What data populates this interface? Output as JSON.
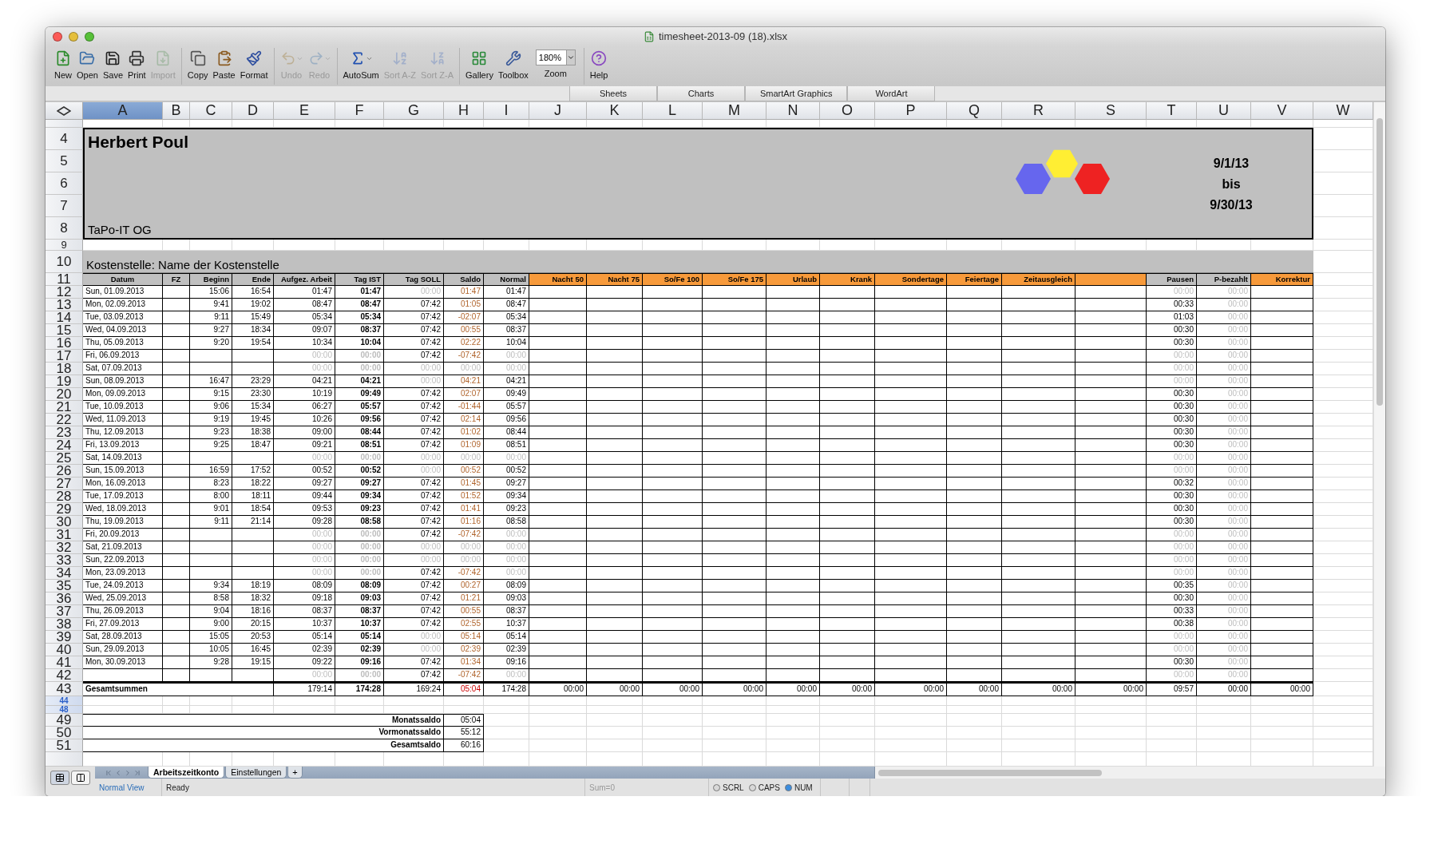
{
  "window": {
    "title": "timesheet-2013-09 (18).xlsx"
  },
  "toolbar": {
    "groups": [
      [
        {
          "kind": "button",
          "label": "New",
          "disabled": false
        },
        {
          "kind": "button",
          "label": "Open",
          "disabled": false
        },
        {
          "kind": "button",
          "label": "Save",
          "disabled": false
        },
        {
          "kind": "button",
          "label": "Print",
          "disabled": false
        },
        {
          "kind": "button",
          "label": "Import",
          "disabled": true
        }
      ],
      [
        {
          "kind": "button",
          "label": "Copy",
          "disabled": false
        },
        {
          "kind": "button",
          "label": "Paste",
          "disabled": false
        },
        {
          "kind": "button",
          "label": "Format",
          "disabled": false
        }
      ],
      [
        {
          "kind": "button",
          "label": "Undo",
          "disabled": true,
          "dropdown": true
        },
        {
          "kind": "button",
          "label": "Redo",
          "disabled": true,
          "dropdown": true
        }
      ],
      [
        {
          "kind": "button",
          "label": "AutoSum",
          "disabled": false,
          "dropdown": true
        },
        {
          "kind": "button",
          "label": "Sort A-Z",
          "disabled": true
        },
        {
          "kind": "button",
          "label": "Sort Z-A",
          "disabled": true
        }
      ],
      [
        {
          "kind": "button",
          "label": "Gallery",
          "disabled": false
        },
        {
          "kind": "button",
          "label": "Toolbox",
          "disabled": false
        },
        {
          "kind": "zoom",
          "label": "Zoom",
          "value": "180%"
        }
      ],
      [
        {
          "kind": "button",
          "label": "Help",
          "disabled": false
        }
      ]
    ]
  },
  "ribbon_tabs": [
    "Sheets",
    "Charts",
    "SmartArt Graphics",
    "WordArt"
  ],
  "column_letters": [
    {
      "label": "A",
      "selected": true
    },
    {
      "label": "B",
      "selected": false
    },
    {
      "label": "C",
      "selected": false
    },
    {
      "label": "D",
      "selected": false
    },
    {
      "label": "E",
      "selected": false
    },
    {
      "label": "F",
      "selected": false
    },
    {
      "label": "G",
      "selected": false
    },
    {
      "label": "H",
      "selected": false
    },
    {
      "label": "I",
      "selected": false
    },
    {
      "label": "J",
      "selected": false
    },
    {
      "label": "K",
      "selected": false
    },
    {
      "label": "L",
      "selected": false
    },
    {
      "label": "M",
      "selected": false
    },
    {
      "label": "N",
      "selected": false
    },
    {
      "label": "O",
      "selected": false
    },
    {
      "label": "P",
      "selected": false
    },
    {
      "label": "Q",
      "selected": false
    },
    {
      "label": "R",
      "selected": false
    },
    {
      "label": "S",
      "selected": false
    },
    {
      "label": "T",
      "selected": false
    },
    {
      "label": "U",
      "selected": false
    },
    {
      "label": "V",
      "selected": false
    },
    {
      "label": "W",
      "selected": false
    }
  ],
  "row_numbers": [
    {
      "highlight": false
    },
    {
      "label": "4",
      "highlight": false
    },
    {
      "label": "5",
      "highlight": false
    },
    {
      "label": "6",
      "highlight": false
    },
    {
      "label": "7",
      "highlight": false
    },
    {
      "label": "8",
      "highlight": false
    },
    {
      "label": "9",
      "highlight": false
    },
    {
      "label": "10",
      "highlight": false
    },
    {
      "label": "11",
      "highlight": false
    },
    {
      "label": "12",
      "highlight": false
    },
    {
      "label": "13",
      "highlight": false
    },
    {
      "label": "14",
      "highlight": false
    },
    {
      "label": "15",
      "highlight": false
    },
    {
      "label": "16",
      "highlight": false
    },
    {
      "label": "17",
      "highlight": false
    },
    {
      "label": "18",
      "highlight": false
    },
    {
      "label": "19",
      "highlight": false
    },
    {
      "label": "20",
      "highlight": false
    },
    {
      "label": "21",
      "highlight": false
    },
    {
      "label": "22",
      "highlight": false
    },
    {
      "label": "23",
      "highlight": false
    },
    {
      "label": "24",
      "highlight": false
    },
    {
      "label": "25",
      "highlight": false
    },
    {
      "label": "26",
      "highlight": false
    },
    {
      "label": "27",
      "highlight": false
    },
    {
      "label": "28",
      "highlight": false
    },
    {
      "label": "29",
      "highlight": false
    },
    {
      "label": "30",
      "highlight": false
    },
    {
      "label": "31",
      "highlight": false
    },
    {
      "label": "32",
      "highlight": false
    },
    {
      "label": "33",
      "highlight": false
    },
    {
      "label": "34",
      "highlight": false
    },
    {
      "label": "35",
      "highlight": false
    },
    {
      "label": "36",
      "highlight": false
    },
    {
      "label": "37",
      "highlight": false
    },
    {
      "label": "38",
      "highlight": false
    },
    {
      "label": "39",
      "highlight": false
    },
    {
      "label": "40",
      "highlight": false
    },
    {
      "label": "41",
      "highlight": false
    },
    {
      "label": "42",
      "highlight": false
    },
    {
      "label": "43",
      "highlight": false
    },
    {
      "label": "44",
      "highlight": true
    },
    {
      "label": "48",
      "highlight": true
    },
    {
      "label": "49",
      "highlight": false
    },
    {
      "label": "50",
      "highlight": false
    },
    {
      "label": "51",
      "highlight": false
    },
    {
      "highlight": false
    }
  ],
  "header": {
    "name": "Herbert Poul",
    "company": "TaPo-IT OG",
    "period": [
      "9/1/13",
      "bis",
      "9/30/13"
    ]
  },
  "cost_center": "Kostenstelle: Name der Kostenstelle",
  "table": {
    "columns": [
      {
        "label": "Datum",
        "color": "#c0c0c0"
      },
      {
        "label": "FZ",
        "color": "#c0c0c0"
      },
      {
        "label": "Beginn",
        "color": "#c0c0c0"
      },
      {
        "label": "Ende",
        "color": "#c0c0c0"
      },
      {
        "label": "Aufgez. Arbeit",
        "color": "#c0c0c0"
      },
      {
        "label": "Tag IST",
        "color": "#c0c0c0"
      },
      {
        "label": "Tag SOLL",
        "color": "#c0c0c0"
      },
      {
        "label": "Saldo",
        "color": "#c0c0c0"
      },
      {
        "label": "Normal",
        "color": "#c0c0c0"
      },
      {
        "label": "Nacht 50",
        "color": "#f79a3b"
      },
      {
        "label": "Nacht 75",
        "color": "#f79a3b"
      },
      {
        "label": "So/Fe 100",
        "color": "#f79a3b"
      },
      {
        "label": "So/Fe 175",
        "color": "#f79a3b"
      },
      {
        "label": "Urlaub",
        "color": "#f79a3b"
      },
      {
        "label": "Krank",
        "color": "#f79a3b"
      },
      {
        "label": "Sondertage",
        "color": "#f79a3b"
      },
      {
        "label": "Feiertage",
        "color": "#f79a3b"
      },
      {
        "label": "Zeitausgleich",
        "color": "#f79a3b"
      },
      {
        "color": "#f79a3b"
      },
      {
        "label": "Pausen",
        "color": "#c0c0c0"
      },
      {
        "label": "P-bezahlt",
        "color": "#c0c0c0"
      },
      {
        "label": "Korrektur",
        "color": "#f79a3b"
      }
    ],
    "rows": [
      {
        "date": "Sun, 01.09.2013",
        "begin": "15:06",
        "end": "16:54",
        "work": "01:47",
        "ist": "01:47",
        "soll": "00:00",
        "saldo": "01:47",
        "normal": "01:47",
        "pause": "00:00",
        "paid": "00:00",
        "muted": {
          "work": false,
          "ist": false,
          "soll": true,
          "saldo": false,
          "normal": false,
          "pause": true,
          "paid": true
        }
      },
      {
        "date": "Mon, 02.09.2013",
        "begin": "9:41",
        "end": "19:02",
        "work": "08:47",
        "ist": "08:47",
        "soll": "07:42",
        "saldo": "01:05",
        "normal": "08:47",
        "pause": "00:33",
        "paid": "00:00",
        "muted": {
          "work": false,
          "ist": false,
          "soll": false,
          "saldo": false,
          "normal": false,
          "pause": false,
          "paid": true
        }
      },
      {
        "date": "Tue, 03.09.2013",
        "begin": "9:11",
        "end": "15:49",
        "work": "05:34",
        "ist": "05:34",
        "soll": "07:42",
        "saldo": "-02:07",
        "normal": "05:34",
        "pause": "01:03",
        "paid": "00:00",
        "muted": {
          "work": false,
          "ist": false,
          "soll": false,
          "saldo": false,
          "normal": false,
          "pause": false,
          "paid": true
        }
      },
      {
        "date": "Wed, 04.09.2013",
        "begin": "9:27",
        "end": "18:34",
        "work": "09:07",
        "ist": "08:37",
        "soll": "07:42",
        "saldo": "00:55",
        "normal": "08:37",
        "pause": "00:30",
        "paid": "00:00",
        "muted": {
          "work": false,
          "ist": false,
          "soll": false,
          "saldo": false,
          "normal": false,
          "pause": false,
          "paid": true
        }
      },
      {
        "date": "Thu, 05.09.2013",
        "begin": "9:20",
        "end": "19:54",
        "work": "10:34",
        "ist": "10:04",
        "soll": "07:42",
        "saldo": "02:22",
        "normal": "10:04",
        "pause": "00:30",
        "paid": "00:00",
        "muted": {
          "work": false,
          "ist": false,
          "soll": false,
          "saldo": false,
          "normal": false,
          "pause": false,
          "paid": true
        }
      },
      {
        "date": "Fri, 06.09.2013",
        "work": "00:00",
        "ist": "00:00",
        "soll": "07:42",
        "saldo": "-07:42",
        "normal": "00:00",
        "pause": "00:00",
        "paid": "00:00",
        "muted": {
          "work": true,
          "ist": true,
          "soll": false,
          "saldo": false,
          "normal": true,
          "pause": true,
          "paid": true
        }
      },
      {
        "date": "Sat, 07.09.2013",
        "work": "00:00",
        "ist": "00:00",
        "soll": "00:00",
        "saldo": "00:00",
        "normal": "00:00",
        "pause": "00:00",
        "paid": "00:00",
        "muted": {
          "work": true,
          "ist": true,
          "soll": true,
          "saldo": true,
          "normal": true,
          "pause": true,
          "paid": true
        }
      },
      {
        "date": "Sun, 08.09.2013",
        "begin": "16:47",
        "end": "23:29",
        "work": "04:21",
        "ist": "04:21",
        "soll": "00:00",
        "saldo": "04:21",
        "normal": "04:21",
        "pause": "00:00",
        "paid": "00:00",
        "muted": {
          "work": false,
          "ist": false,
          "soll": true,
          "saldo": false,
          "normal": false,
          "pause": true,
          "paid": true
        }
      },
      {
        "date": "Mon, 09.09.2013",
        "begin": "9:15",
        "end": "23:30",
        "work": "10:19",
        "ist": "09:49",
        "soll": "07:42",
        "saldo": "02:07",
        "normal": "09:49",
        "pause": "00:30",
        "paid": "00:00",
        "muted": {
          "work": false,
          "ist": false,
          "soll": false,
          "saldo": false,
          "normal": false,
          "pause": false,
          "paid": true
        }
      },
      {
        "date": "Tue, 10.09.2013",
        "begin": "9:06",
        "end": "15:34",
        "work": "06:27",
        "ist": "05:57",
        "soll": "07:42",
        "saldo": "-01:44",
        "normal": "05:57",
        "pause": "00:30",
        "paid": "00:00",
        "muted": {
          "work": false,
          "ist": false,
          "soll": false,
          "saldo": false,
          "normal": false,
          "pause": false,
          "paid": true
        }
      },
      {
        "date": "Wed, 11.09.2013",
        "begin": "9:19",
        "end": "19:45",
        "work": "10:26",
        "ist": "09:56",
        "soll": "07:42",
        "saldo": "02:14",
        "normal": "09:56",
        "pause": "00:30",
        "paid": "00:00",
        "muted": {
          "work": false,
          "ist": false,
          "soll": false,
          "saldo": false,
          "normal": false,
          "pause": false,
          "paid": true
        }
      },
      {
        "date": "Thu, 12.09.2013",
        "begin": "9:23",
        "end": "18:38",
        "work": "09:00",
        "ist": "08:44",
        "soll": "07:42",
        "saldo": "01:02",
        "normal": "08:44",
        "pause": "00:30",
        "paid": "00:00",
        "muted": {
          "work": false,
          "ist": false,
          "soll": false,
          "saldo": false,
          "normal": false,
          "pause": false,
          "paid": true
        }
      },
      {
        "date": "Fri, 13.09.2013",
        "begin": "9:25",
        "end": "18:47",
        "work": "09:21",
        "ist": "08:51",
        "soll": "07:42",
        "saldo": "01:09",
        "normal": "08:51",
        "pause": "00:30",
        "paid": "00:00",
        "muted": {
          "work": false,
          "ist": false,
          "soll": false,
          "saldo": false,
          "normal": false,
          "pause": false,
          "paid": true
        }
      },
      {
        "date": "Sat, 14.09.2013",
        "work": "00:00",
        "ist": "00:00",
        "soll": "00:00",
        "saldo": "00:00",
        "normal": "00:00",
        "pause": "00:00",
        "paid": "00:00",
        "muted": {
          "work": true,
          "ist": true,
          "soll": true,
          "saldo": true,
          "normal": true,
          "pause": true,
          "paid": true
        }
      },
      {
        "date": "Sun, 15.09.2013",
        "begin": "16:59",
        "end": "17:52",
        "work": "00:52",
        "ist": "00:52",
        "soll": "00:00",
        "saldo": "00:52",
        "normal": "00:52",
        "pause": "00:00",
        "paid": "00:00",
        "muted": {
          "work": false,
          "ist": false,
          "soll": true,
          "saldo": false,
          "normal": false,
          "pause": true,
          "paid": true
        }
      },
      {
        "date": "Mon, 16.09.2013",
        "begin": "8:23",
        "end": "18:22",
        "work": "09:27",
        "ist": "09:27",
        "soll": "07:42",
        "saldo": "01:45",
        "normal": "09:27",
        "pause": "00:32",
        "paid": "00:00",
        "muted": {
          "work": false,
          "ist": false,
          "soll": false,
          "saldo": false,
          "normal": false,
          "pause": false,
          "paid": true
        }
      },
      {
        "date": "Tue, 17.09.2013",
        "begin": "8:00",
        "end": "18:11",
        "work": "09:44",
        "ist": "09:34",
        "soll": "07:42",
        "saldo": "01:52",
        "normal": "09:34",
        "pause": "00:30",
        "paid": "00:00",
        "muted": {
          "work": false,
          "ist": false,
          "soll": false,
          "saldo": false,
          "normal": false,
          "pause": false,
          "paid": true
        }
      },
      {
        "date": "Wed, 18.09.2013",
        "begin": "9:01",
        "end": "18:54",
        "work": "09:53",
        "ist": "09:23",
        "soll": "07:42",
        "saldo": "01:41",
        "normal": "09:23",
        "pause": "00:30",
        "paid": "00:00",
        "muted": {
          "work": false,
          "ist": false,
          "soll": false,
          "saldo": false,
          "normal": false,
          "pause": false,
          "paid": true
        }
      },
      {
        "date": "Thu, 19.09.2013",
        "begin": "9:11",
        "end": "21:14",
        "work": "09:28",
        "ist": "08:58",
        "soll": "07:42",
        "saldo": "01:16",
        "normal": "08:58",
        "pause": "00:30",
        "paid": "00:00",
        "muted": {
          "work": false,
          "ist": false,
          "soll": false,
          "saldo": false,
          "normal": false,
          "pause": false,
          "paid": true
        }
      },
      {
        "date": "Fri, 20.09.2013",
        "work": "00:00",
        "ist": "00:00",
        "soll": "07:42",
        "saldo": "-07:42",
        "normal": "00:00",
        "pause": "00:00",
        "paid": "00:00",
        "muted": {
          "work": true,
          "ist": true,
          "soll": false,
          "saldo": false,
          "normal": true,
          "pause": true,
          "paid": true
        }
      },
      {
        "date": "Sat, 21.09.2013",
        "work": "00:00",
        "ist": "00:00",
        "soll": "00:00",
        "saldo": "00:00",
        "normal": "00:00",
        "pause": "00:00",
        "paid": "00:00",
        "muted": {
          "work": true,
          "ist": true,
          "soll": true,
          "saldo": true,
          "normal": true,
          "pause": true,
          "paid": true
        }
      },
      {
        "date": "Sun, 22.09.2013",
        "work": "00:00",
        "ist": "00:00",
        "soll": "00:00",
        "saldo": "00:00",
        "normal": "00:00",
        "pause": "00:00",
        "paid": "00:00",
        "muted": {
          "work": true,
          "ist": true,
          "soll": true,
          "saldo": true,
          "normal": true,
          "pause": true,
          "paid": true
        }
      },
      {
        "date": "Mon, 23.09.2013",
        "work": "00:00",
        "ist": "00:00",
        "soll": "07:42",
        "saldo": "-07:42",
        "normal": "00:00",
        "pause": "00:00",
        "paid": "00:00",
        "muted": {
          "work": true,
          "ist": true,
          "soll": false,
          "saldo": false,
          "normal": true,
          "pause": true,
          "paid": true
        }
      },
      {
        "date": "Tue, 24.09.2013",
        "begin": "9:34",
        "end": "18:19",
        "work": "08:09",
        "ist": "08:09",
        "soll": "07:42",
        "saldo": "00:27",
        "normal": "08:09",
        "pause": "00:35",
        "paid": "00:00",
        "muted": {
          "work": false,
          "ist": false,
          "soll": false,
          "saldo": false,
          "normal": false,
          "pause": false,
          "paid": true
        }
      },
      {
        "date": "Wed, 25.09.2013",
        "begin": "8:58",
        "end": "18:32",
        "work": "09:18",
        "ist": "09:03",
        "soll": "07:42",
        "saldo": "01:21",
        "normal": "09:03",
        "pause": "00:30",
        "paid": "00:00",
        "muted": {
          "work": false,
          "ist": false,
          "soll": false,
          "saldo": false,
          "normal": false,
          "pause": false,
          "paid": true
        }
      },
      {
        "date": "Thu, 26.09.2013",
        "begin": "9:04",
        "end": "18:16",
        "work": "08:37",
        "ist": "08:37",
        "soll": "07:42",
        "saldo": "00:55",
        "normal": "08:37",
        "pause": "00:33",
        "paid": "00:00",
        "muted": {
          "work": false,
          "ist": false,
          "soll": false,
          "saldo": false,
          "normal": false,
          "pause": false,
          "paid": true
        }
      },
      {
        "date": "Fri, 27.09.2013",
        "begin": "9:00",
        "end": "20:15",
        "work": "10:37",
        "ist": "10:37",
        "soll": "07:42",
        "saldo": "02:55",
        "normal": "10:37",
        "pause": "00:38",
        "paid": "00:00",
        "muted": {
          "work": false,
          "ist": false,
          "soll": false,
          "saldo": false,
          "normal": false,
          "pause": false,
          "paid": true
        }
      },
      {
        "date": "Sat, 28.09.2013",
        "begin": "15:05",
        "end": "20:53",
        "work": "05:14",
        "ist": "05:14",
        "soll": "00:00",
        "saldo": "05:14",
        "normal": "05:14",
        "pause": "00:00",
        "paid": "00:00",
        "muted": {
          "work": false,
          "ist": false,
          "soll": true,
          "saldo": false,
          "normal": false,
          "pause": true,
          "paid": true
        }
      },
      {
        "date": "Sun, 29.09.2013",
        "begin": "10:05",
        "end": "16:45",
        "work": "02:39",
        "ist": "02:39",
        "soll": "00:00",
        "saldo": "02:39",
        "normal": "02:39",
        "pause": "00:00",
        "paid": "00:00",
        "muted": {
          "work": false,
          "ist": false,
          "soll": true,
          "saldo": false,
          "normal": false,
          "pause": true,
          "paid": true
        }
      },
      {
        "date": "Mon, 30.09.2013",
        "begin": "9:28",
        "end": "19:15",
        "work": "09:22",
        "ist": "09:16",
        "soll": "07:42",
        "saldo": "01:34",
        "normal": "09:16",
        "pause": "00:30",
        "paid": "00:00",
        "muted": {
          "work": false,
          "ist": false,
          "soll": false,
          "saldo": false,
          "normal": false,
          "pause": false,
          "paid": true
        }
      },
      {
        "work": "00:00",
        "ist": "00:00",
        "soll": "07:42",
        "saldo": "-07:42",
        "normal": "00:00",
        "pause": "00:00",
        "paid": "00:00",
        "muted": {
          "work": true,
          "ist": true,
          "soll": false,
          "saldo": false,
          "normal": true,
          "pause": true,
          "paid": true
        }
      }
    ],
    "totals": {
      "label": "Gesamtsummen",
      "values": [
        "179:14",
        "174:28",
        "169:24",
        "05:04",
        "174:28",
        "00:00",
        "00:00",
        "00:00",
        "00:00",
        "00:00",
        "00:00",
        "00:00",
        "00:00",
        "00:00",
        "00:00",
        "09:57",
        "00:00",
        "00:00"
      ]
    }
  },
  "summary": [
    {
      "label": "Monatssaldo",
      "value": "05:04"
    },
    {
      "label": "Vormonatssaldo",
      "value": "55:12"
    },
    {
      "label": "Gesamtsaldo",
      "value": "60:16"
    }
  ],
  "sheet_tabs": [
    {
      "label": "Arbeitszeitkonto",
      "selected": true
    },
    {
      "label": "Einstellungen",
      "selected": false
    }
  ],
  "add_sheet": "+",
  "status_bar": {
    "view": "Normal View",
    "mode": "Ready",
    "sum": "Sum=0",
    "indicators": [
      {
        "label": "SCRL",
        "on": false
      },
      {
        "label": "CAPS",
        "on": false
      },
      {
        "label": "NUM",
        "on": true
      }
    ]
  }
}
